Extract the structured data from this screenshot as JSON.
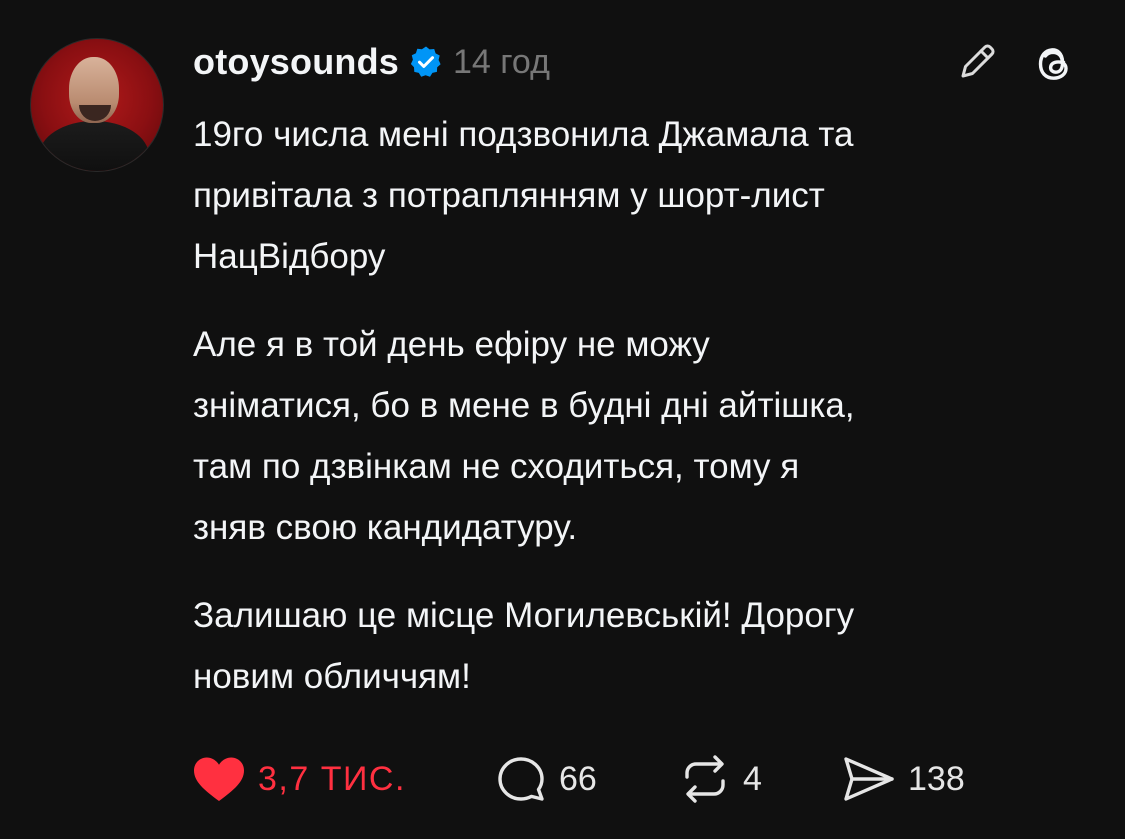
{
  "post": {
    "username": "otoysounds",
    "verified": true,
    "timestamp": "14 год",
    "paragraphs": [
      "19го числа мені подзвонила Джамала та\nпривітала з потраплянням у шорт-лист\nНацВідбору",
      "Але я в той день ефіру не можу\nзніматися, бо в мене в будні дні айтішка,\nтам по дзвінкам не сходиться, тому я\nзняв свою кандидатуру.",
      "Залишаю це місце Могилевській! Дорогу\nновим обличчям!"
    ],
    "actions": {
      "likes": "3,7 ТИС.",
      "replies": "66",
      "reposts": "4",
      "shares": "138"
    }
  },
  "colors": {
    "background": "#101010",
    "text": "#f3f5f7",
    "muted": "#777777",
    "like": "#ff3040",
    "verified": "#0095f6"
  },
  "icons": [
    "verified-badge-icon",
    "edit-pencil-icon",
    "threads-logo-icon",
    "heart-icon",
    "comment-icon",
    "repost-icon",
    "share-icon"
  ]
}
